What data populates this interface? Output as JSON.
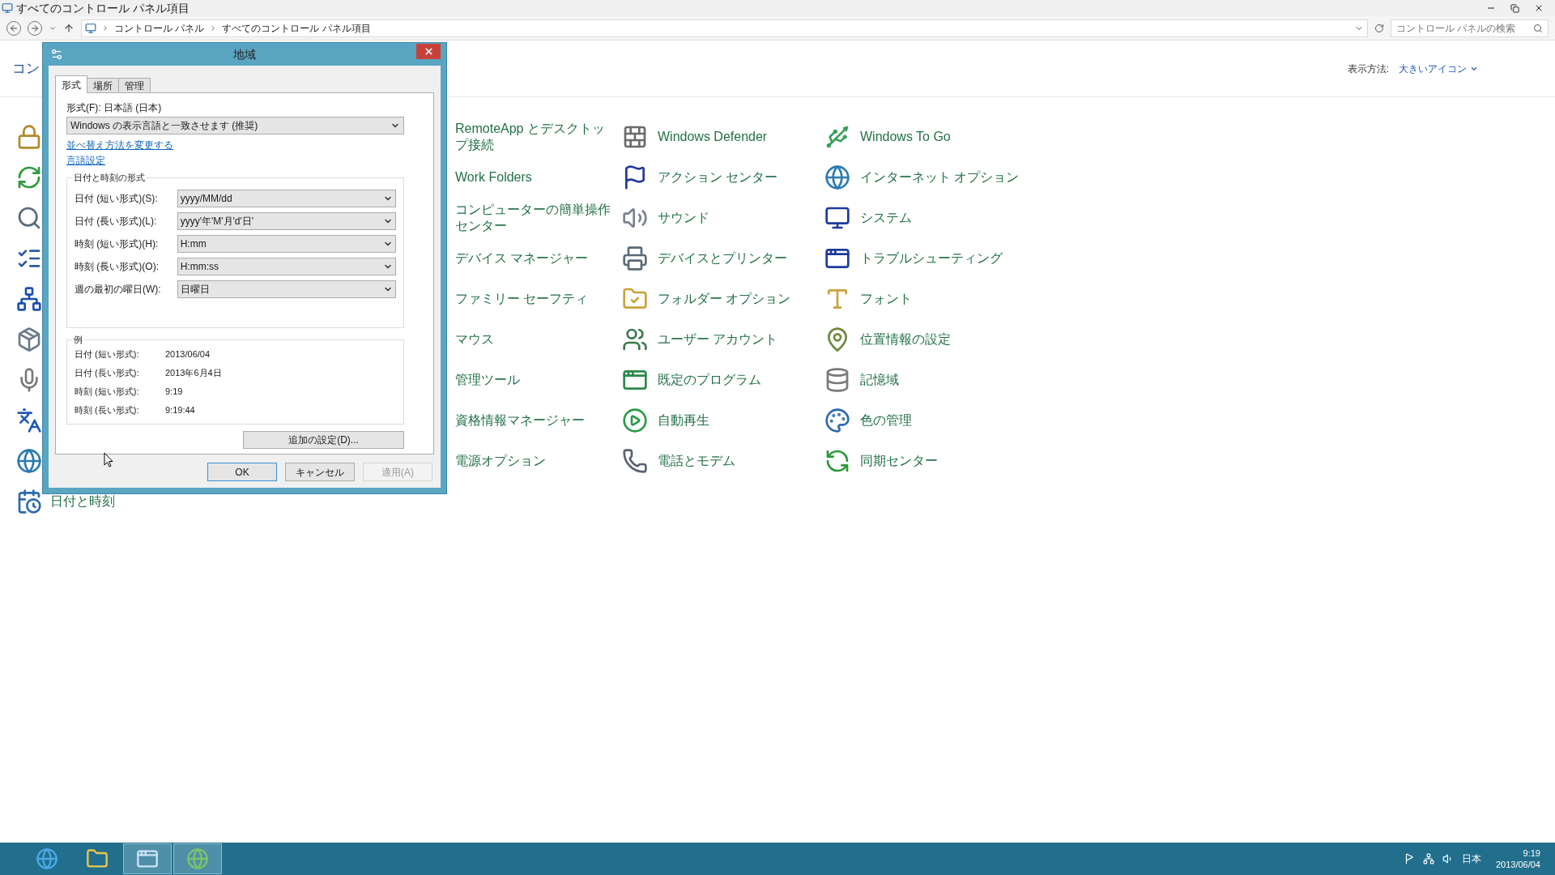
{
  "window": {
    "title": "すべてのコントロール パネル項目"
  },
  "address_bar": {
    "breadcrumbs": [
      "コントロール パネル",
      "すべてのコントロール パネル項目"
    ]
  },
  "search": {
    "placeholder": "コントロール パネルの検索"
  },
  "header": {
    "title": "コン",
    "view_label": "表示方法:",
    "view_value": "大きいアイコン"
  },
  "left_column": {
    "last_item": "日付と時刻"
  },
  "columns": [
    [
      {
        "label": "RemoteApp とデスクトップ接続"
      },
      {
        "label": "Work Folders"
      },
      {
        "label": "コンピューターの簡単操作センター"
      },
      {
        "label": "デバイス マネージャー"
      },
      {
        "label": "ファミリー セーフティ"
      },
      {
        "label": "マウス"
      },
      {
        "label": "管理ツール"
      },
      {
        "label": "資格情報マネージャー"
      },
      {
        "label": "電源オプション"
      }
    ],
    [
      {
        "label": "Windows Defender"
      },
      {
        "label": "アクション センター"
      },
      {
        "label": "サウンド"
      },
      {
        "label": "デバイスとプリンター"
      },
      {
        "label": "フォルダー オプション"
      },
      {
        "label": "ユーザー アカウント"
      },
      {
        "label": "既定のプログラム"
      },
      {
        "label": "自動再生"
      },
      {
        "label": "電話とモデム"
      }
    ],
    [
      {
        "label": "Windows To Go"
      },
      {
        "label": "インターネット オプション"
      },
      {
        "label": "システム"
      },
      {
        "label": "トラブルシューティング"
      },
      {
        "label": "フォント"
      },
      {
        "label": "位置情報の設定"
      },
      {
        "label": "記憶域"
      },
      {
        "label": "色の管理"
      },
      {
        "label": "同期センター"
      }
    ]
  ],
  "dialog": {
    "title": "地域",
    "tabs": [
      {
        "label": "形式",
        "selected": true
      },
      {
        "label": "場所",
        "selected": false
      },
      {
        "label": "管理",
        "selected": false
      }
    ],
    "format_label": "形式(F): 日本語 (日本)",
    "format_value": "Windows の表示言語と一致させます (推奨)",
    "links": [
      "並べ替え方法を変更する",
      "言語設定"
    ],
    "formats_group": {
      "title": "日付と時刻の形式",
      "rows": [
        {
          "label": "日付 (短い形式)(S):",
          "value": "yyyy/MM/dd"
        },
        {
          "label": "日付 (長い形式)(L):",
          "value": "yyyy'年'M'月'd'日'"
        },
        {
          "label": "時刻 (短い形式)(H):",
          "value": "H:mm"
        },
        {
          "label": "時刻 (長い形式)(O):",
          "value": "H:mm:ss"
        },
        {
          "label": "週の最初の曜日(W):",
          "value": "日曜日"
        }
      ]
    },
    "example_group": {
      "title": "例",
      "rows": [
        {
          "label": "日付 (短い形式):",
          "value": "2013/06/04"
        },
        {
          "label": "日付 (長い形式):",
          "value": "2013年6月4日"
        },
        {
          "label": "時刻 (短い形式):",
          "value": "9:19"
        },
        {
          "label": "時刻 (長い形式):",
          "value": "9:19:44"
        }
      ]
    },
    "additional_button": "追加の設定(D)...",
    "buttons": [
      {
        "label": "OK",
        "default": true,
        "disabled": false
      },
      {
        "label": "キャンセル",
        "default": false,
        "disabled": false
      },
      {
        "label": "適用(A)",
        "default": false,
        "disabled": true
      }
    ]
  },
  "taskbar": {
    "apps": [
      {
        "selected": false
      },
      {
        "selected": false
      },
      {
        "selected": true
      },
      {
        "selected": true
      }
    ],
    "language": "日本",
    "time": "9:19",
    "date": "2013/06/04"
  }
}
